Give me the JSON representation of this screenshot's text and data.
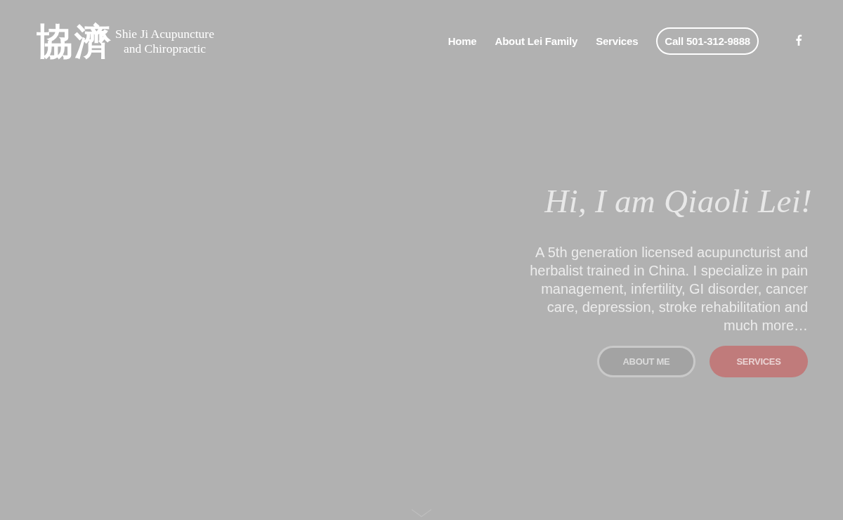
{
  "header": {
    "logo": {
      "characters": "協濟",
      "line_1": "Shie Ji Acupuncture",
      "line_2": "and Chiropractic"
    },
    "nav": [
      {
        "label": "Home",
        "kind": "link"
      },
      {
        "label": "About Lei Family",
        "kind": "link"
      },
      {
        "label": "Services",
        "kind": "link"
      },
      {
        "label": "Call 501-312-9888",
        "kind": "pill"
      }
    ]
  },
  "hero": {
    "heading": "Hi, I am Qiaoli Lei!",
    "text": "A 5th generation licensed acupuncturist and herbalist trained in China. I specialize in pain management, infertility, GI disorder, cancer care, depression, stroke rehabilitation and much more…",
    "buttons": [
      {
        "label": "ABOUT ME",
        "kind": "outline"
      },
      {
        "label": "SERVICES",
        "kind": "filled"
      }
    ]
  }
}
